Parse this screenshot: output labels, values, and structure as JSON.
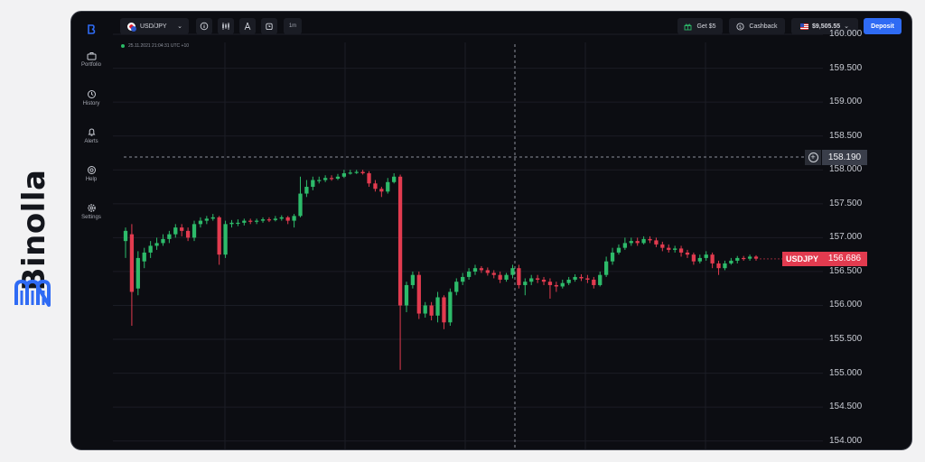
{
  "brand": {
    "name": "Binolla"
  },
  "sidebar": {
    "items": [
      {
        "label": "Portfolio",
        "icon": "briefcase-icon"
      },
      {
        "label": "History",
        "icon": "history-icon"
      },
      {
        "label": "Alerts",
        "icon": "bell-icon"
      },
      {
        "label": "Help",
        "icon": "help-icon"
      },
      {
        "label": "Settings",
        "icon": "gear-icon"
      }
    ]
  },
  "toolbar": {
    "pair": "USD/JPY",
    "timeframe": "1m",
    "bonus_label": "Get $5",
    "cashback_label": "Cashback",
    "balance": "$9,505.55",
    "deposit_label": "Deposit"
  },
  "chart": {
    "timestamp": "25.11.2021  21:04:31  UTC +10",
    "crosshair_value": "158.190",
    "symbol_tag": "USDJPY",
    "current_price": "156.686"
  },
  "colors": {
    "up": "#2dbb6a",
    "down": "#e23b4f",
    "accent": "#2f6bf4",
    "background": "#0c0d12"
  },
  "chart_data": {
    "type": "candlestick",
    "ylim": [
      153.85,
      160.2
    ],
    "y_ticks": [
      "160.000",
      "159.500",
      "159.000",
      "158.500",
      "158.000",
      "157.500",
      "157.000",
      "156.500",
      "156.000",
      "155.500",
      "155.000",
      "154.500",
      "154.000"
    ],
    "crosshair": 158.19,
    "current": 156.686,
    "candles": [
      [
        156.95,
        157.1,
        157.15,
        156.7
      ],
      [
        157.05,
        156.2,
        157.2,
        155.7
      ],
      [
        156.25,
        156.7,
        156.8,
        156.15
      ],
      [
        156.65,
        156.78,
        156.85,
        156.55
      ],
      [
        156.78,
        156.88,
        156.95,
        156.7
      ],
      [
        156.88,
        156.92,
        157.0,
        156.82
      ],
      [
        156.92,
        156.98,
        157.05,
        156.88
      ],
      [
        156.98,
        157.05,
        157.1,
        156.92
      ],
      [
        157.05,
        157.15,
        157.2,
        157.0
      ],
      [
        157.15,
        157.1,
        157.2,
        157.02
      ],
      [
        157.1,
        157.0,
        157.15,
        156.95
      ],
      [
        157.0,
        157.2,
        157.25,
        156.95
      ],
      [
        157.2,
        157.25,
        157.3,
        157.15
      ],
      [
        157.25,
        157.28,
        157.32,
        157.2
      ],
      [
        157.28,
        157.3,
        157.35,
        157.25
      ],
      [
        157.3,
        156.75,
        157.32,
        156.6
      ],
      [
        156.75,
        157.2,
        157.25,
        156.7
      ],
      [
        157.2,
        157.22,
        157.26,
        157.15
      ],
      [
        157.22,
        157.22,
        157.27,
        157.17
      ],
      [
        157.22,
        157.25,
        157.28,
        157.18
      ],
      [
        157.25,
        157.24,
        157.28,
        157.2
      ],
      [
        157.24,
        157.25,
        157.28,
        157.2
      ],
      [
        157.25,
        157.27,
        157.3,
        157.22
      ],
      [
        157.27,
        157.26,
        157.3,
        157.23
      ],
      [
        157.26,
        157.28,
        157.32,
        157.24
      ],
      [
        157.28,
        157.3,
        157.33,
        157.25
      ],
      [
        157.3,
        157.25,
        157.32,
        157.2
      ],
      [
        157.25,
        157.32,
        157.35,
        157.15
      ],
      [
        157.32,
        157.65,
        157.9,
        157.3
      ],
      [
        157.65,
        157.75,
        157.85,
        157.6
      ],
      [
        157.75,
        157.85,
        157.9,
        157.7
      ],
      [
        157.85,
        157.85,
        157.9,
        157.8
      ],
      [
        157.85,
        157.88,
        157.92,
        157.82
      ],
      [
        157.88,
        157.87,
        157.92,
        157.84
      ],
      [
        157.87,
        157.9,
        157.94,
        157.85
      ],
      [
        157.9,
        157.95,
        158.0,
        157.88
      ],
      [
        157.95,
        157.96,
        158.0,
        157.93
      ],
      [
        157.96,
        157.97,
        158.0,
        157.94
      ],
      [
        157.97,
        157.95,
        158.0,
        157.93
      ],
      [
        157.95,
        157.8,
        157.98,
        157.75
      ],
      [
        157.8,
        157.72,
        157.85,
        157.68
      ],
      [
        157.72,
        157.68,
        157.75,
        157.6
      ],
      [
        157.68,
        157.82,
        157.88,
        157.65
      ],
      [
        157.82,
        157.9,
        157.95,
        157.8
      ],
      [
        157.9,
        156.0,
        157.93,
        155.05
      ],
      [
        156.0,
        156.3,
        156.35,
        155.9
      ],
      [
        156.3,
        156.45,
        156.5,
        156.25
      ],
      [
        156.45,
        155.88,
        156.5,
        155.8
      ],
      [
        155.88,
        156.0,
        156.05,
        155.82
      ],
      [
        156.0,
        155.85,
        156.05,
        155.78
      ],
      [
        155.85,
        156.12,
        156.2,
        155.75
      ],
      [
        156.12,
        155.75,
        156.15,
        155.65
      ],
      [
        155.75,
        156.2,
        156.25,
        155.7
      ],
      [
        156.2,
        156.35,
        156.4,
        156.15
      ],
      [
        156.35,
        156.42,
        156.48,
        156.3
      ],
      [
        156.42,
        156.5,
        156.55,
        156.38
      ],
      [
        156.5,
        156.55,
        156.6,
        156.45
      ],
      [
        156.55,
        156.52,
        156.58,
        156.48
      ],
      [
        156.52,
        156.48,
        156.56,
        156.44
      ],
      [
        156.48,
        156.45,
        156.52,
        156.4
      ],
      [
        156.45,
        156.38,
        156.5,
        156.33
      ],
      [
        156.38,
        156.45,
        156.48,
        156.35
      ],
      [
        156.45,
        156.55,
        156.6,
        156.4
      ],
      [
        156.55,
        156.3,
        156.6,
        156.25
      ],
      [
        156.3,
        156.35,
        156.4,
        156.15
      ],
      [
        156.35,
        156.4,
        156.45,
        156.3
      ],
      [
        156.4,
        156.38,
        156.45,
        156.33
      ],
      [
        156.38,
        156.35,
        156.42,
        156.3
      ],
      [
        156.35,
        156.3,
        156.4,
        156.1
      ],
      [
        156.3,
        156.28,
        156.35,
        156.2
      ],
      [
        156.28,
        156.33,
        156.38,
        156.25
      ],
      [
        156.33,
        156.38,
        156.42,
        156.3
      ],
      [
        156.38,
        156.42,
        156.46,
        156.35
      ],
      [
        156.42,
        156.4,
        156.46,
        156.36
      ],
      [
        156.4,
        156.38,
        156.45,
        156.33
      ],
      [
        156.38,
        156.3,
        156.42,
        156.25
      ],
      [
        156.3,
        156.45,
        156.5,
        156.28
      ],
      [
        156.45,
        156.65,
        156.72,
        156.42
      ],
      [
        156.65,
        156.78,
        156.85,
        156.6
      ],
      [
        156.78,
        156.85,
        156.9,
        156.75
      ],
      [
        156.85,
        156.92,
        157.0,
        156.82
      ],
      [
        156.92,
        156.95,
        157.0,
        156.88
      ],
      [
        156.95,
        156.92,
        157.0,
        156.88
      ],
      [
        156.92,
        156.98,
        157.02,
        156.9
      ],
      [
        156.98,
        156.96,
        157.02,
        156.92
      ],
      [
        156.96,
        156.9,
        157.0,
        156.86
      ],
      [
        156.9,
        156.85,
        156.94,
        156.8
      ],
      [
        156.85,
        156.82,
        156.9,
        156.78
      ],
      [
        156.82,
        156.84,
        156.88,
        156.78
      ],
      [
        156.84,
        156.78,
        156.88,
        156.72
      ],
      [
        156.78,
        156.75,
        156.82,
        156.7
      ],
      [
        156.75,
        156.65,
        156.78,
        156.6
      ],
      [
        156.65,
        156.7,
        156.75,
        156.62
      ],
      [
        156.7,
        156.75,
        156.8,
        156.66
      ],
      [
        156.75,
        156.62,
        156.78,
        156.55
      ],
      [
        156.62,
        156.55,
        156.66,
        156.45
      ],
      [
        156.55,
        156.62,
        156.66,
        156.52
      ],
      [
        156.62,
        156.66,
        156.7,
        156.6
      ],
      [
        156.66,
        156.7,
        156.73,
        156.62
      ],
      [
        156.7,
        156.69,
        156.73,
        156.66
      ],
      [
        156.69,
        156.72,
        156.75,
        156.66
      ],
      [
        156.72,
        156.69,
        156.74,
        156.66
      ]
    ]
  }
}
